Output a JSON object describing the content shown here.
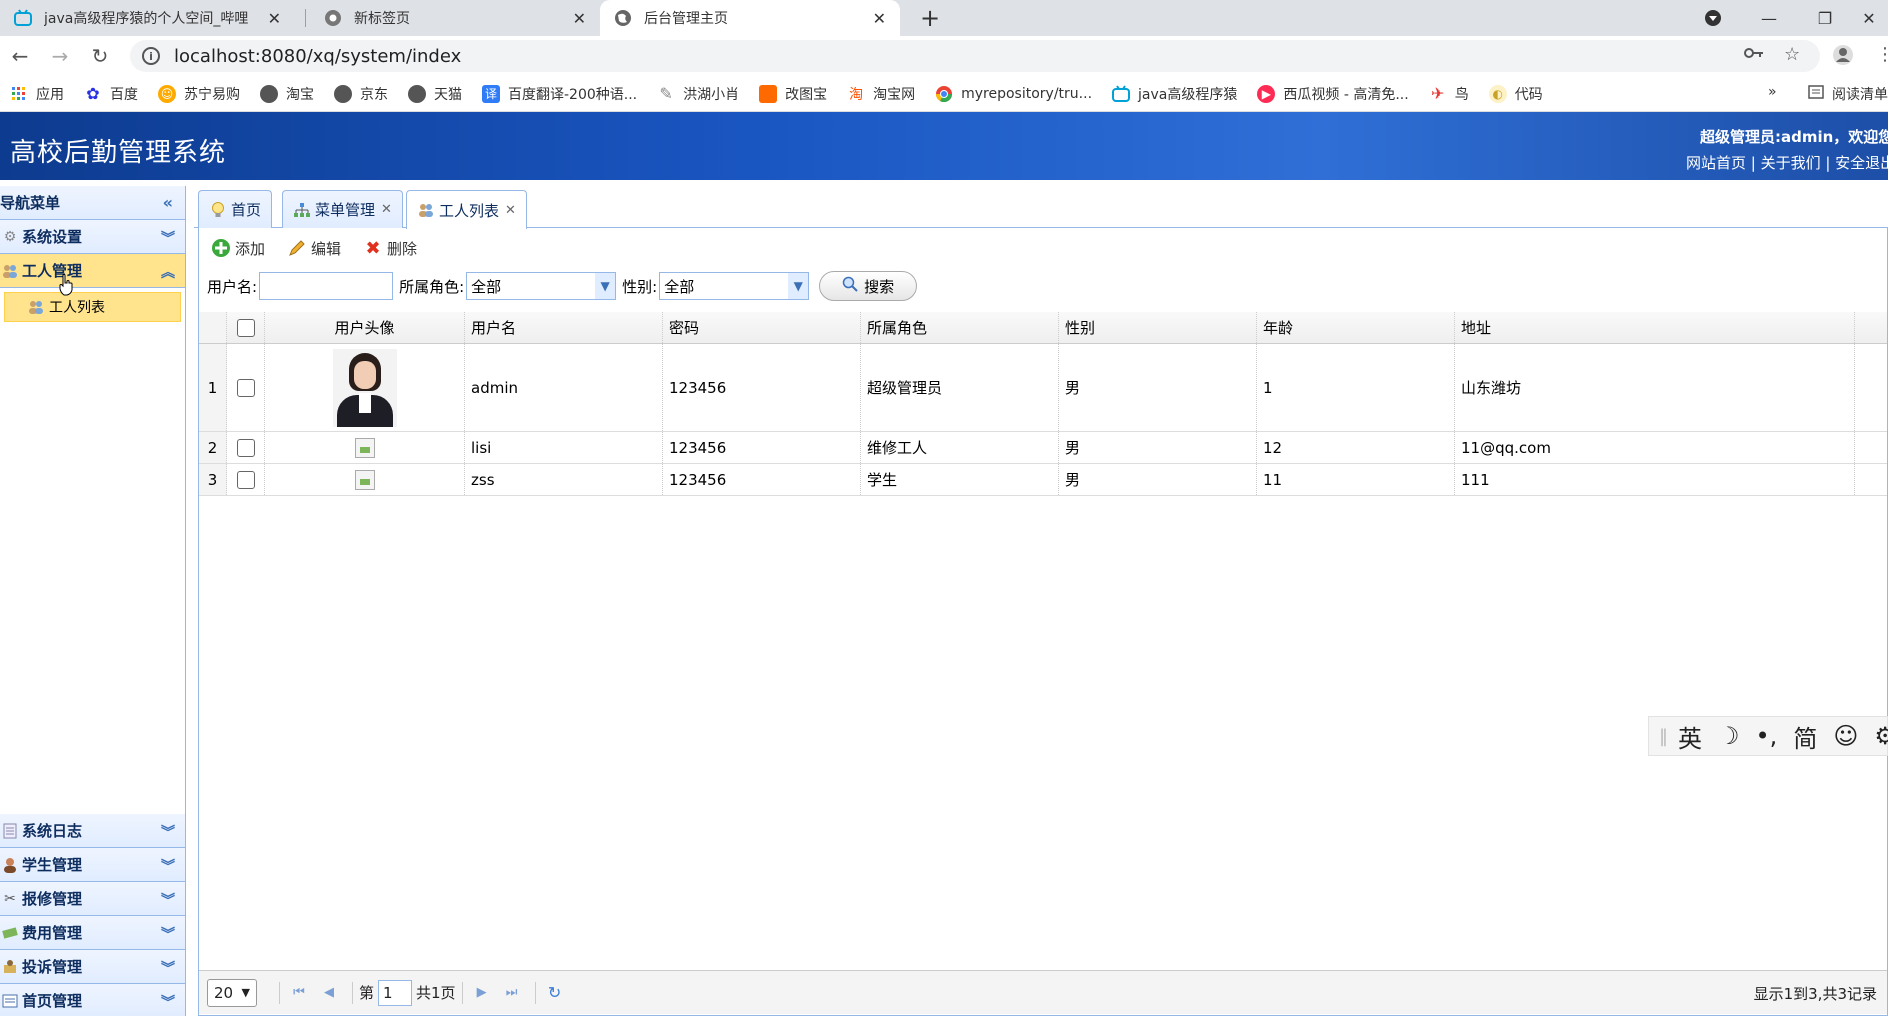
{
  "browser": {
    "tabs": [
      {
        "title": "java高级程序猿的个人空间_哔哩",
        "icon": "bilibili-icon"
      },
      {
        "title": "新标签页",
        "icon": "chrome-icon"
      },
      {
        "title": "后台管理主页",
        "icon": "globe-icon"
      }
    ],
    "url": "localhost:8080/xq/system/index",
    "bookmarks": [
      {
        "label": "应用",
        "icon": "apps-grid-icon",
        "color": "#4285f4"
      },
      {
        "label": "百度",
        "icon": "baidu-paw-icon",
        "color": "#2932e1"
      },
      {
        "label": "苏宁易购",
        "icon": "suning-icon",
        "color": "#ffaa00"
      },
      {
        "label": "淘宝",
        "icon": "globe-icon",
        "color": "#555555"
      },
      {
        "label": "京东",
        "icon": "globe-icon",
        "color": "#555555"
      },
      {
        "label": "天猫",
        "icon": "globe-icon",
        "color": "#555555"
      },
      {
        "label": "百度翻译-200种语...",
        "icon": "translate-icon",
        "color": "#2f7cf6"
      },
      {
        "label": "洪湖小肖",
        "icon": "bird-icon",
        "color": "#888888"
      },
      {
        "label": "改图宝",
        "icon": "gaitubao-icon",
        "color": "#ff6a00"
      },
      {
        "label": "淘宝网",
        "icon": "taobao-icon",
        "color": "#ff5000"
      },
      {
        "label": "myrepository/tru...",
        "icon": "chrome-icon",
        "color": "#34a853"
      },
      {
        "label": "java高级程序猿",
        "icon": "bilibili-icon",
        "color": "#00a1d6"
      },
      {
        "label": "西瓜视频 - 高清免...",
        "icon": "xigua-icon",
        "color": "#fe2c55"
      },
      {
        "label": "鸟",
        "icon": "bird-icon",
        "color": "#e53935"
      },
      {
        "label": "代码",
        "icon": "code-icon",
        "color": "#f5c242"
      }
    ],
    "more": "»",
    "reading_list": "阅读清单"
  },
  "app": {
    "title": "高校后勤管理系统",
    "user_greeting": "超级管理员:admin，欢迎您",
    "links": "网站首页 | 关于我们 | 安全退出"
  },
  "sidebar": {
    "title": "导航菜单",
    "top_sections": [
      {
        "label": "系统设置",
        "icon": "gear-icon",
        "expanded": false
      },
      {
        "label": "工人管理",
        "icon": "users-icon",
        "expanded": true
      }
    ],
    "sub_items": [
      {
        "label": "工人列表",
        "icon": "users-icon"
      }
    ],
    "bottom_sections": [
      {
        "label": "系统日志",
        "icon": "log-icon"
      },
      {
        "label": "学生管理",
        "icon": "student-icon"
      },
      {
        "label": "报修管理",
        "icon": "tools-icon"
      },
      {
        "label": "费用管理",
        "icon": "money-icon"
      },
      {
        "label": "投诉管理",
        "icon": "complaint-icon"
      },
      {
        "label": "首页管理",
        "icon": "home-admin-icon"
      }
    ]
  },
  "page_tabs": [
    {
      "label": "首页",
      "icon": "bulb-icon",
      "closable": false
    },
    {
      "label": "菜单管理",
      "icon": "tree-icon",
      "closable": true
    },
    {
      "label": "工人列表",
      "icon": "users-icon",
      "closable": true
    }
  ],
  "toolbar": {
    "add": "添加",
    "edit": "编辑",
    "delete": "删除"
  },
  "search": {
    "username_label": "用户名:",
    "username_value": "",
    "role_label": "所属角色:",
    "role_value": "全部",
    "gender_label": "性别:",
    "gender_value": "全部",
    "search_button": "搜索"
  },
  "table": {
    "headers": [
      "用户头像",
      "用户名",
      "密码",
      "所属角色",
      "性别",
      "年龄",
      "地址"
    ],
    "rows": [
      {
        "num": "1",
        "avatar": "photo",
        "username": "admin",
        "password": "123456",
        "role": "超级管理员",
        "gender": "男",
        "age": "1",
        "address": "山东潍坊"
      },
      {
        "num": "2",
        "avatar": "broken",
        "username": "lisi",
        "password": "123456",
        "role": "维修工人",
        "gender": "男",
        "age": "12",
        "address": "11@qq.com"
      },
      {
        "num": "3",
        "avatar": "broken",
        "username": "zss",
        "password": "123456",
        "role": "学生",
        "gender": "男",
        "age": "11",
        "address": "111"
      }
    ]
  },
  "pager": {
    "page_size": "20",
    "page_prefix": "第",
    "page_value": "1",
    "page_total": "共1页",
    "info": "显示1到3,共3记录"
  },
  "ime": {
    "lang": "英",
    "moon": "☽",
    "punct": "•,",
    "simplified": "简",
    "emoji": "☺",
    "gear": "⚙"
  },
  "colors": {
    "header_blue": "#1a56c2",
    "accent_yellow": "#ffe48d",
    "border_blue": "#95b8e7"
  }
}
